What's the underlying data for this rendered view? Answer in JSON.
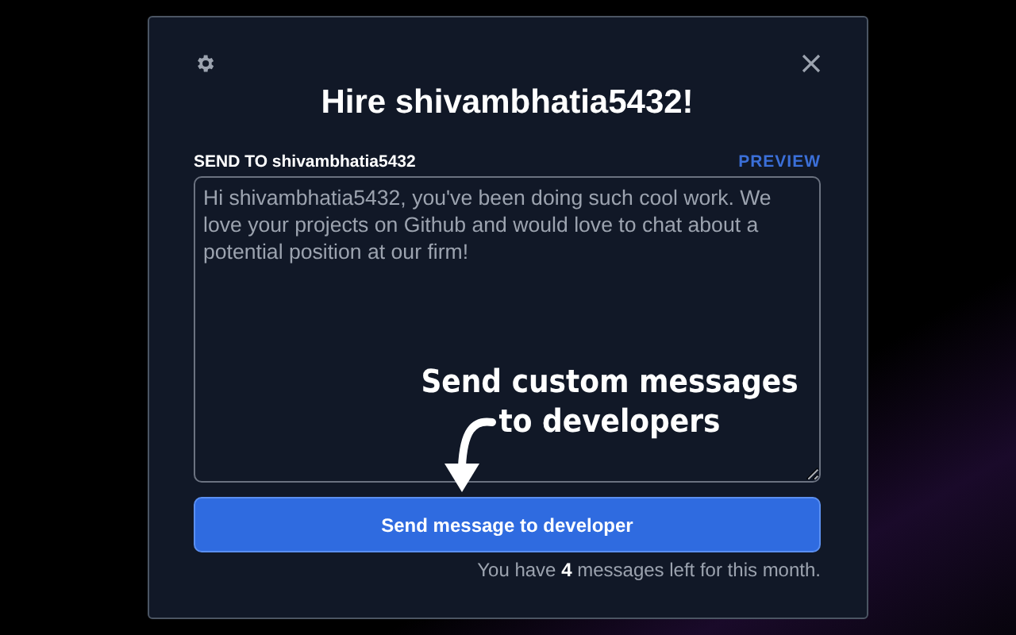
{
  "dialog": {
    "title": "Hire shivambhatia5432!",
    "recipient_label": "SEND TO shivambhatia5432",
    "preview_link": "PREVIEW",
    "message": "Hi shivambhatia5432, you've been doing such cool work. We love your projects on Github and would love to chat about a potential position at our firm!",
    "send_button": "Send message to developer",
    "quota_note": "You have **4** messages left for this month."
  },
  "callout": {
    "lines": [
      "Send custom messages",
      "to developers"
    ]
  }
}
